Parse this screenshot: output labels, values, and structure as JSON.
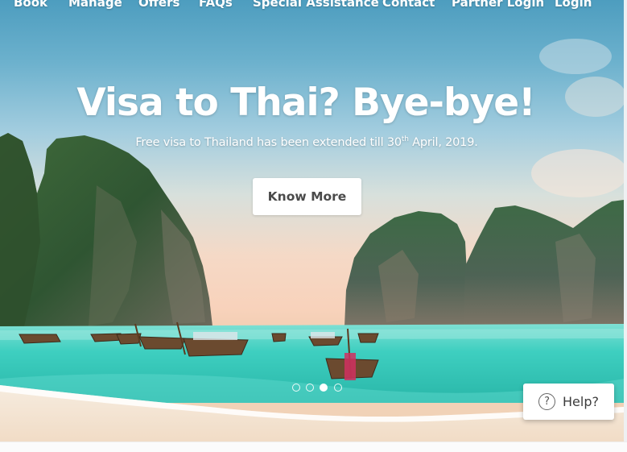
{
  "nav": {
    "items": [
      {
        "label": "Book"
      },
      {
        "label": "Manage"
      },
      {
        "label": "Offers"
      },
      {
        "label": "FAQs"
      },
      {
        "label": "Special Assistance"
      },
      {
        "label": "Contact"
      },
      {
        "label": "Partner Login"
      },
      {
        "label": "Login"
      }
    ]
  },
  "hero": {
    "headline": "Visa to Thai? Bye-bye!",
    "subline_before": "Free visa to Thailand has been extended till 30",
    "subline_sup": "th",
    "subline_after": " April, 2019.",
    "cta_label": "Know More"
  },
  "carousel": {
    "slide_count": 4,
    "active_index": 2
  },
  "help": {
    "icon": "question-circle-icon",
    "icon_glyph": "?",
    "label": "Help?"
  },
  "colors": {
    "sea": "#3ecfc0",
    "sky": "#6cb1cd",
    "rock": "#3b5a3a",
    "cta_text": "#4a4a4a"
  }
}
